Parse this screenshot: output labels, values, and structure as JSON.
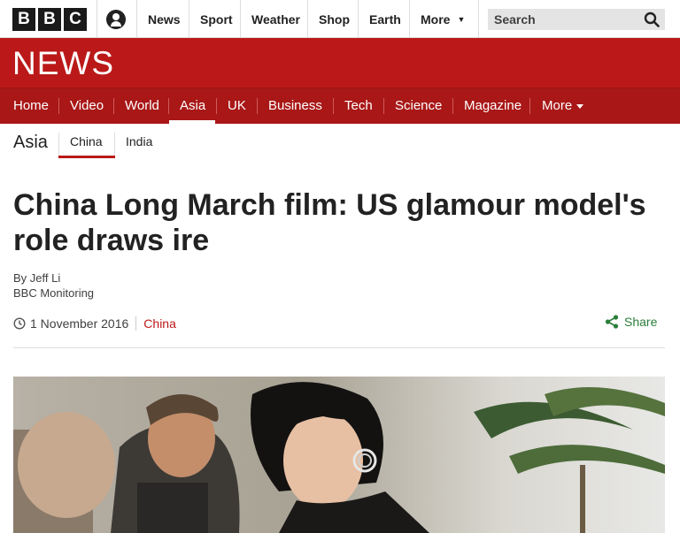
{
  "brand": {
    "letters": [
      "B",
      "B",
      "C"
    ]
  },
  "topnav": {
    "items": [
      "News",
      "Sport",
      "Weather",
      "Shop",
      "Earth"
    ],
    "more_label": "More",
    "search_placeholder": "Search"
  },
  "news_band": {
    "wordmark": "NEWS"
  },
  "section_nav": {
    "items": [
      "Home",
      "Video",
      "World",
      "Asia",
      "UK",
      "Business",
      "Tech",
      "Science",
      "Magazine",
      "More"
    ],
    "active": "Asia"
  },
  "subnav": {
    "title": "Asia",
    "items": [
      "China",
      "India"
    ],
    "active": "China"
  },
  "article": {
    "headline": "China Long March film: US glamour model's role draws ire",
    "author": "By Jeff Li",
    "author_org": "BBC Monitoring",
    "date": "1 November 2016",
    "topic": "China",
    "share_label": "Share"
  },
  "colors": {
    "brand_red": "#bb1919",
    "nav_red": "#a91717",
    "share_green": "#2a7e3a"
  }
}
